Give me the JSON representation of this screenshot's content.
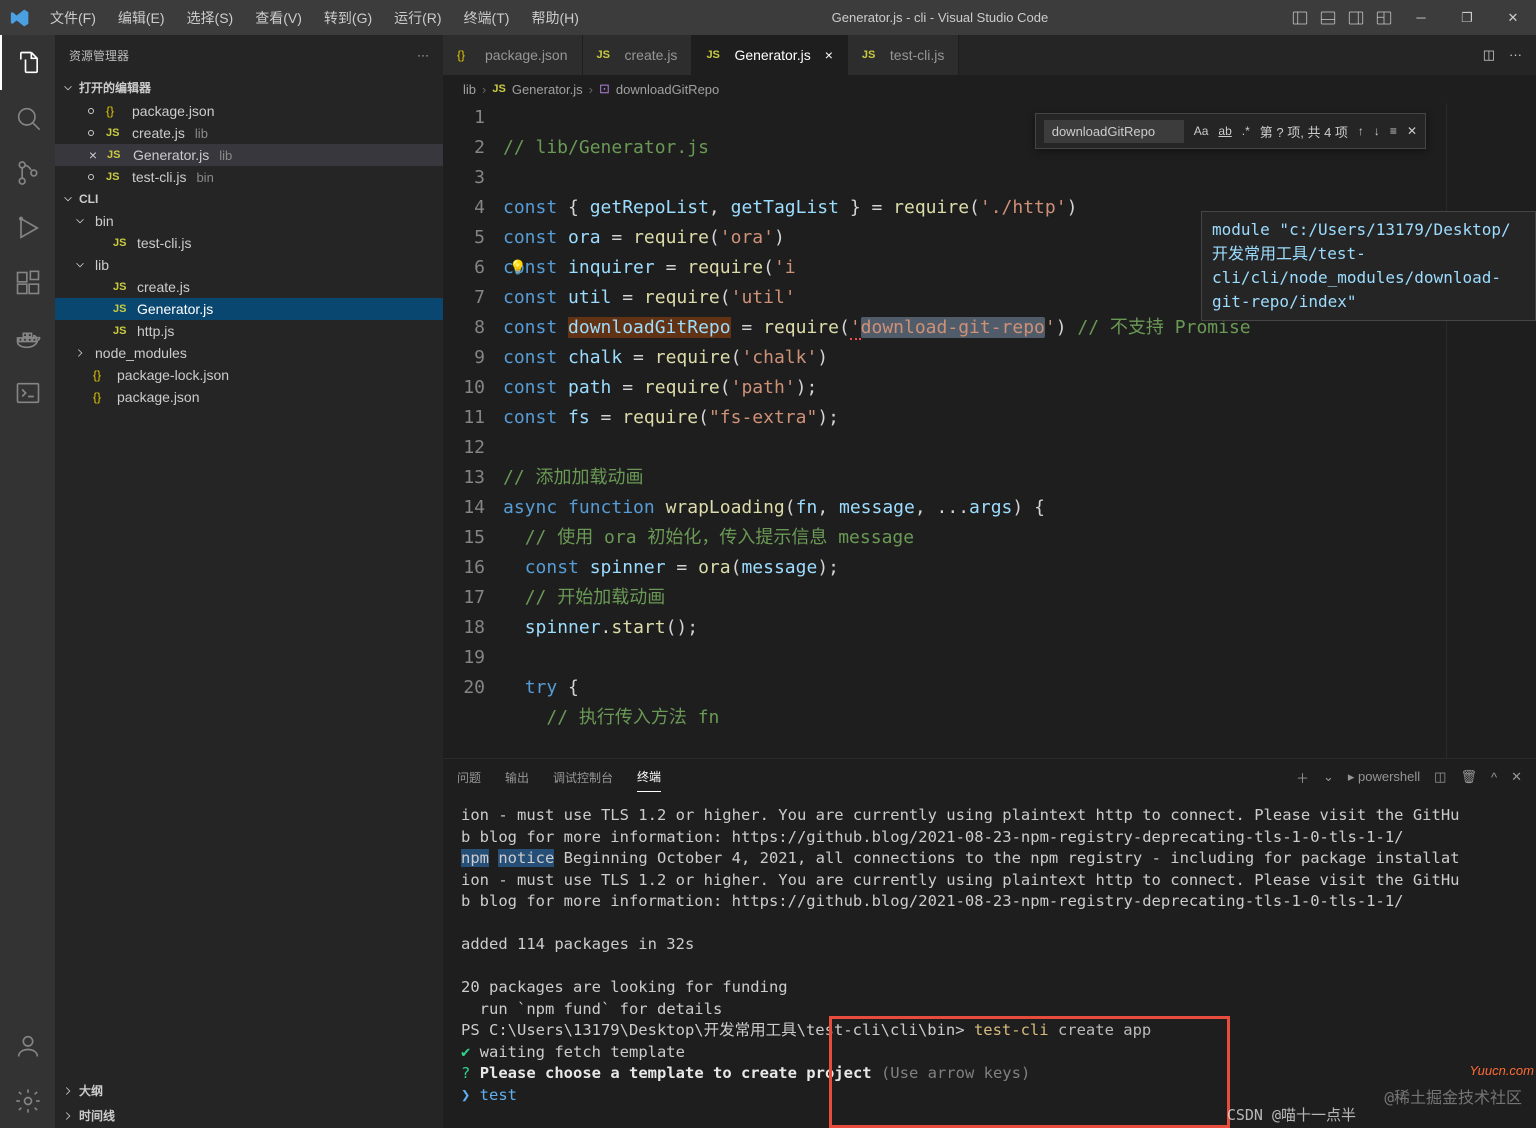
{
  "titlebar": {
    "title": "Generator.js - cli - Visual Studio Code",
    "menu": [
      "文件(F)",
      "编辑(E)",
      "选择(S)",
      "查看(V)",
      "转到(G)",
      "运行(R)",
      "终端(T)",
      "帮助(H)"
    ]
  },
  "sidebar": {
    "title": "资源管理器",
    "openEditors": "打开的编辑器",
    "openItems": [
      {
        "icon": "{}",
        "name": "package.json",
        "cls": "ico-json"
      },
      {
        "icon": "JS",
        "name": "create.js",
        "hint": "lib",
        "cls": "ico-js"
      },
      {
        "icon": "JS",
        "name": "Generator.js",
        "hint": "lib",
        "cls": "ico-js",
        "active": true
      },
      {
        "icon": "JS",
        "name": "test-cli.js",
        "hint": "bin",
        "cls": "ico-js"
      }
    ],
    "project": "CLI",
    "tree": [
      {
        "t": "folder",
        "n": "bin",
        "l": 1,
        "open": true
      },
      {
        "t": "js",
        "n": "test-cli.js",
        "l": 2
      },
      {
        "t": "folder",
        "n": "lib",
        "l": 1,
        "open": true
      },
      {
        "t": "js",
        "n": "create.js",
        "l": 2
      },
      {
        "t": "js",
        "n": "Generator.js",
        "l": 2,
        "sel": true
      },
      {
        "t": "js",
        "n": "http.js",
        "l": 2
      },
      {
        "t": "folder",
        "n": "node_modules",
        "l": 1,
        "open": false
      },
      {
        "t": "json",
        "n": "package-lock.json",
        "l": 1,
        "noarrow": true
      },
      {
        "t": "json",
        "n": "package.json",
        "l": 1,
        "noarrow": true
      }
    ],
    "outline": "大纲",
    "timeline": "时间线"
  },
  "tabs": [
    {
      "icon": "{}",
      "label": "package.json",
      "cls": "ico-json"
    },
    {
      "icon": "JS",
      "label": "create.js",
      "cls": "ico-js"
    },
    {
      "icon": "JS",
      "label": "Generator.js",
      "cls": "ico-js",
      "active": true
    },
    {
      "icon": "JS",
      "label": "test-cli.js",
      "cls": "ico-js"
    }
  ],
  "breadcrumb": [
    "lib",
    "JS Generator.js",
    "downloadGitRepo"
  ],
  "search": {
    "value": "downloadGitRepo",
    "result": "第 ? 项, 共 4 项"
  },
  "hover": "module \"c:/Users/13179/Desktop/开发常用工具/test-cli/cli/node_modules/download-git-repo/index\"",
  "code": {
    "lines": [
      1,
      2,
      3,
      4,
      5,
      6,
      7,
      8,
      9,
      10,
      11,
      12,
      13,
      14,
      15,
      16,
      17,
      18,
      19,
      20
    ]
  },
  "panel": {
    "tabs": [
      "问题",
      "输出",
      "调试控制台",
      "终端"
    ],
    "shell": "powershell"
  },
  "watermark": "@稀土掘金技术社区",
  "watermark2": "CSDN @喵十一点半",
  "yuu": "Yuucn.com"
}
